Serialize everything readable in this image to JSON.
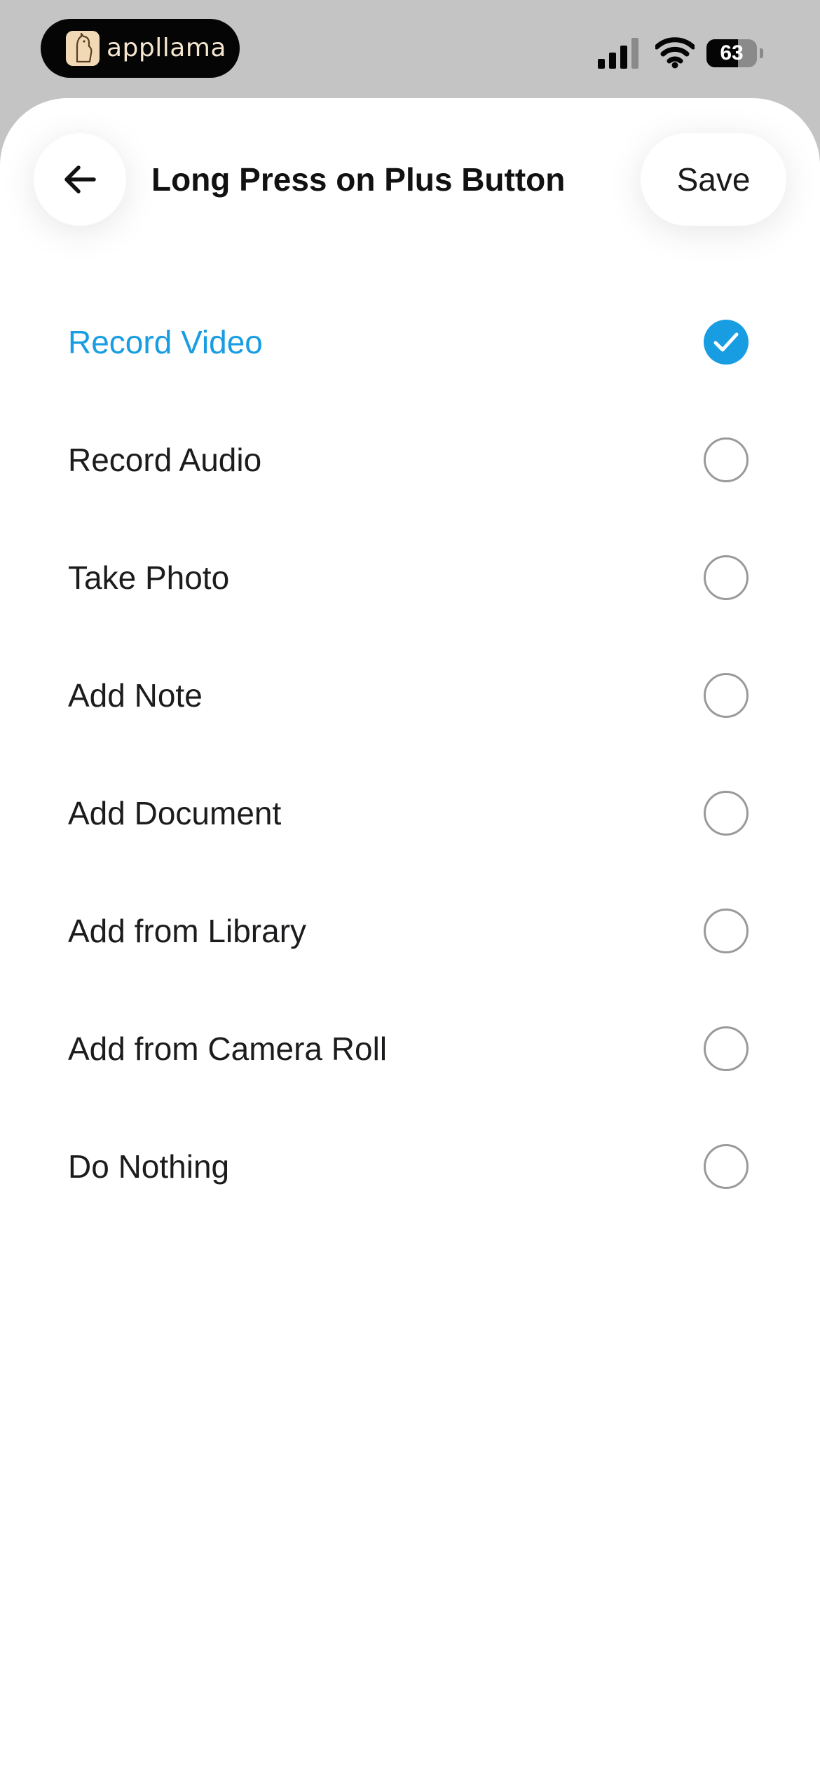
{
  "status_bar": {
    "brand_name": "appllama",
    "battery_level": "63",
    "battery_fraction": 0.63,
    "icons": [
      "llama-logo-icon",
      "cellular-signal-icon",
      "wifi-icon",
      "battery-icon"
    ]
  },
  "header": {
    "title": "Long Press on Plus Button",
    "save_label": "Save",
    "back_icon": "arrow-left-icon"
  },
  "options": [
    {
      "label": "Record Video",
      "selected": true
    },
    {
      "label": "Record Audio",
      "selected": false
    },
    {
      "label": "Take Photo",
      "selected": false
    },
    {
      "label": "Add Note",
      "selected": false
    },
    {
      "label": "Add Document",
      "selected": false
    },
    {
      "label": "Add from Library",
      "selected": false
    },
    {
      "label": "Add from Camera Roll",
      "selected": false
    },
    {
      "label": "Do Nothing",
      "selected": false
    }
  ],
  "colors": {
    "accent": "#189de2",
    "status_bar_bg": "#c4c4c4",
    "text": "#1c1c1e",
    "radio_border": "#9a9a9a"
  }
}
